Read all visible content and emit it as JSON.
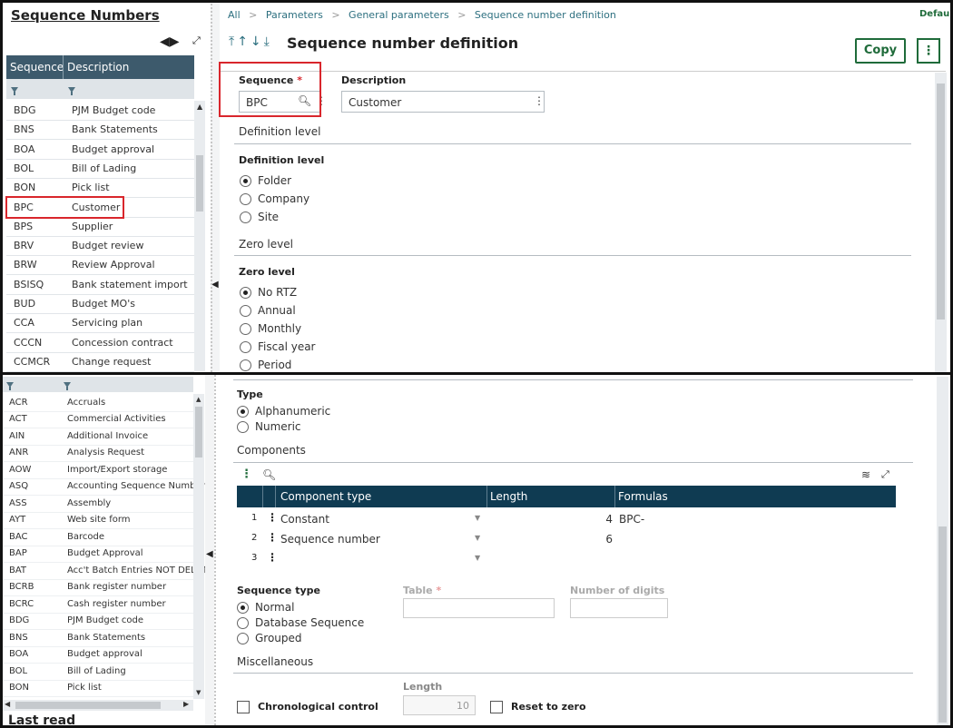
{
  "left_panel": {
    "title": "Sequence Numbers",
    "columns": [
      "Sequence",
      "Description"
    ],
    "rows_top": [
      [
        "BDG",
        "PJM Budget code"
      ],
      [
        "BNS",
        "Bank Statements"
      ],
      [
        "BOA",
        "Budget approval"
      ],
      [
        "BOL",
        "Bill of Lading"
      ],
      [
        "BON",
        "Pick list"
      ],
      [
        "BPC",
        "Customer"
      ],
      [
        "BPS",
        "Supplier"
      ],
      [
        "BRV",
        "Budget review"
      ],
      [
        "BRW",
        "Review Approval"
      ],
      [
        "BSISQ",
        "Bank statement import"
      ],
      [
        "BUD",
        "Budget MO's"
      ],
      [
        "CCA",
        "Servicing plan"
      ],
      [
        "CCCN",
        "Concession contract"
      ],
      [
        "CCMCR",
        "Change request"
      ]
    ],
    "rows_bottom": [
      [
        "ACR",
        "Accruals"
      ],
      [
        "ACT",
        "Commercial Activities"
      ],
      [
        "AIN",
        "Additional Invoice"
      ],
      [
        "ANR",
        "Analysis Request"
      ],
      [
        "AOW",
        "Import/Export storage"
      ],
      [
        "ASQ",
        "Accounting Sequence Number"
      ],
      [
        "ASS",
        "Assembly"
      ],
      [
        "AYT",
        "Web site form"
      ],
      [
        "BAC",
        "Barcode"
      ],
      [
        "BAP",
        "Budget Approval"
      ],
      [
        "BAT",
        "Acc't Batch Entries NOT DELETE"
      ],
      [
        "BCRB",
        "Bank register number"
      ],
      [
        "BCRC",
        "Cash register number"
      ],
      [
        "BDG",
        "PJM Budget code"
      ],
      [
        "BNS",
        "Bank Statements"
      ],
      [
        "BOA",
        "Budget approval"
      ],
      [
        "BOL",
        "Bill of Lading"
      ],
      [
        "BON",
        "Pick list"
      ]
    ],
    "last_read": "Last read"
  },
  "breadcrumb": [
    "All",
    "Parameters",
    "General parameters",
    "Sequence number definition"
  ],
  "default_link": "Default",
  "page_title": "Sequence number definition",
  "copy_label": "Copy",
  "form": {
    "sequence_label": "Sequence",
    "sequence_value": "BPC",
    "description_label": "Description",
    "description_value": "Customer",
    "definition_section": "Definition level",
    "definition_label": "Definition level",
    "definition_options": [
      "Folder",
      "Company",
      "Site"
    ],
    "zero_section": "Zero level",
    "zero_label": "Zero level",
    "zero_options": [
      "No RTZ",
      "Annual",
      "Monthly",
      "Fiscal year",
      "Period"
    ],
    "type_label": "Type",
    "type_options": [
      "Alphanumeric",
      "Numeric"
    ],
    "components_section": "Components",
    "grid_columns": [
      "Component type",
      "Length",
      "Formulas"
    ],
    "grid_rows": [
      {
        "n": "1",
        "type": "Constant",
        "length": "4",
        "formula": "BPC-"
      },
      {
        "n": "2",
        "type": "Sequence number",
        "length": "6",
        "formula": ""
      },
      {
        "n": "3",
        "type": "",
        "length": "",
        "formula": ""
      }
    ],
    "seq_type_label": "Sequence type",
    "seq_type_options": [
      "Normal",
      "Database Sequence",
      "Grouped"
    ],
    "table_label": "Table",
    "digits_label": "Number of digits",
    "misc_section": "Miscellaneous",
    "length_label": "Length",
    "length_value": "10",
    "chrono_label": "Chronological control",
    "reset_label": "Reset to zero"
  },
  "colors": {
    "header": "#3d5a6c",
    "grid_header": "#0f3b52",
    "accent": "#1f6b3a",
    "highlight": "#d9262c"
  }
}
